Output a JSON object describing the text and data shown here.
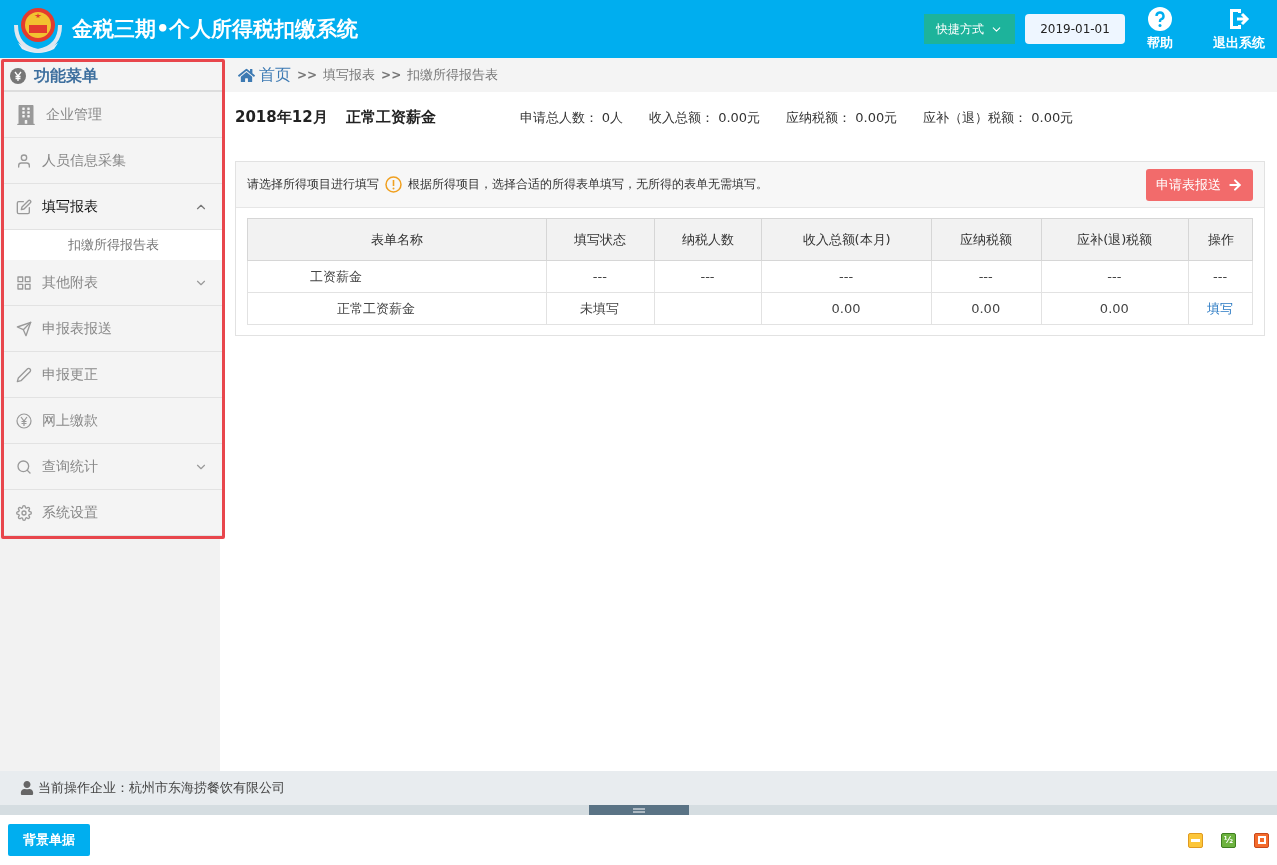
{
  "header": {
    "title": "金税三期•个人所得税扣缴系统",
    "shortcut": "快捷方式",
    "date": "2019-01-01",
    "help": "帮助",
    "logout": "退出系统"
  },
  "sidebar": {
    "title": "功能菜单",
    "items": [
      {
        "label": "企业管理",
        "kind": "link"
      },
      {
        "label": "人员信息采集",
        "kind": "link"
      },
      {
        "label": "填写报表",
        "kind": "group",
        "expanded": true,
        "children": [
          {
            "label": "扣缴所得报告表"
          }
        ]
      },
      {
        "label": "其他附表",
        "kind": "group",
        "expanded": false
      },
      {
        "label": "申报表报送",
        "kind": "link"
      },
      {
        "label": "申报更正",
        "kind": "link"
      },
      {
        "label": "网上缴款",
        "kind": "link"
      },
      {
        "label": "查询统计",
        "kind": "group",
        "expanded": false
      },
      {
        "label": "系统设置",
        "kind": "link"
      }
    ]
  },
  "breadcrumb": [
    "首页",
    "填写报表",
    "扣缴所得报告表"
  ],
  "breadcrumb_separator": ">>",
  "summary": {
    "period": "2018年12月",
    "type": "正常工资薪金",
    "stats": [
      "申请总人数： 0人",
      "收入总额： 0.00元",
      "应纳税额： 0.00元",
      "应补（退）税额： 0.00元"
    ]
  },
  "notice": {
    "prompt": "请选择所得项目进行填写",
    "hint": "根据所得项目，选择合适的所得表单填写，无所得的表单无需填写。",
    "submit": "申请表报送"
  },
  "table": {
    "columns": [
      "表单名称",
      "填写状态",
      "纳税人数",
      "收入总额(本月)",
      "应纳税额",
      "应补(退)税额",
      "操作"
    ],
    "rows": [
      {
        "kind": "group",
        "cells": [
          "工资薪金",
          "---",
          "---",
          "---",
          "---",
          "---",
          "---"
        ]
      },
      {
        "kind": "item",
        "cells": [
          "正常工资薪金",
          "未填写",
          "",
          "0.00",
          "0.00",
          "0.00",
          "填写"
        ]
      }
    ]
  },
  "status_bar": {
    "company": "当前操作企业：杭州市东海捞餐饮有限公司"
  },
  "footer": {
    "button": "背景单据",
    "half": "½"
  }
}
